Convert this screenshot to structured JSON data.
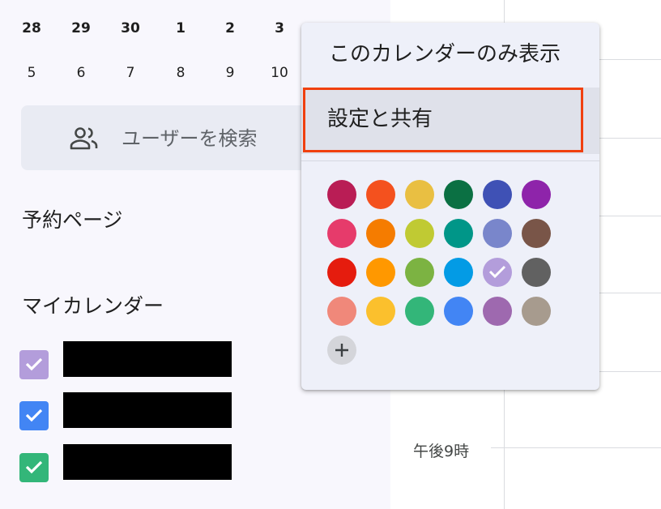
{
  "mini_calendar": {
    "row1": [
      "28",
      "29",
      "30",
      "1",
      "2",
      "3"
    ],
    "row2": [
      "5",
      "6",
      "7",
      "8",
      "9",
      "10"
    ]
  },
  "search_users": {
    "label": "ユーザーを検索",
    "icon": "people-icon"
  },
  "sections": {
    "booking_pages": "予約ページ",
    "my_calendars": "マイカレンダー"
  },
  "my_calendars": [
    {
      "color": "#b39ddb",
      "checked": true
    },
    {
      "color": "#4285f4",
      "checked": true
    },
    {
      "color": "#33b679",
      "checked": true
    }
  ],
  "grid": {
    "time_label": "午後9時"
  },
  "menu": {
    "items": [
      {
        "label": "このカレンダーのみ表示"
      },
      {
        "label": "設定と共有",
        "highlighted": true
      }
    ],
    "palette": [
      [
        "#b91d55",
        "#f4511e",
        "#e9bf42",
        "#0b7043",
        "#3f51b5",
        "#8e24aa"
      ],
      [
        "#e63b6b",
        "#f57c00",
        "#c0ca33",
        "#009688",
        "#7986cb",
        "#795548"
      ],
      [
        "#e51c0e",
        "#ff9800",
        "#7cb342",
        "#039be5",
        "#b39ddb",
        "#616161"
      ],
      [
        "#f0887a",
        "#fbc02d",
        "#33b679",
        "#4285f4",
        "#9e69af",
        "#a79b8e"
      ]
    ],
    "selected_color": "#b39ddb",
    "add_color_icon": "plus-icon"
  }
}
